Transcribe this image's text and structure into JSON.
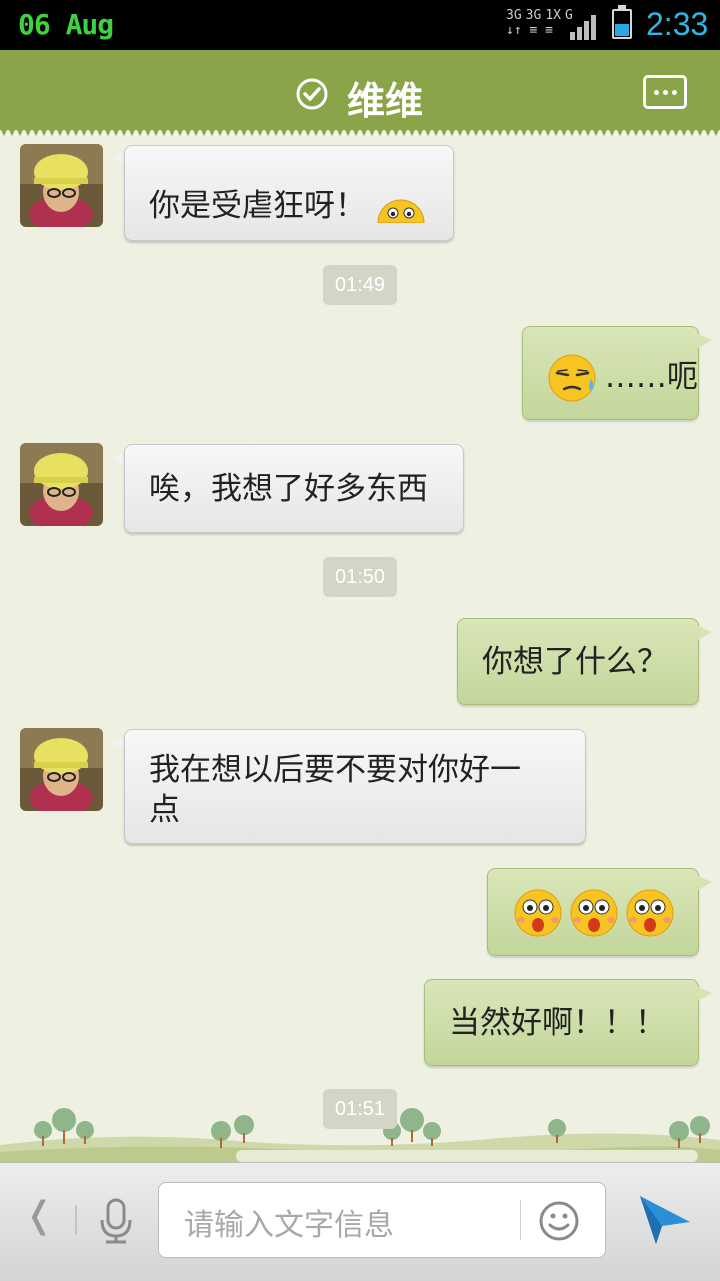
{
  "status_bar": {
    "date": "06 Aug",
    "network_top": [
      "3G",
      "3G",
      "1X",
      "G"
    ],
    "time": "2:33",
    "colors": {
      "date": "#3fd13f",
      "time": "#33b5e5",
      "battery": "#2aa6e0"
    }
  },
  "header": {
    "title": "维维",
    "status_icon": "check-circle-icon",
    "menu_icon": "chat-more-icon",
    "color": "#8aa449"
  },
  "messages": [
    {
      "side": "left",
      "text": "你是受虐狂呀！",
      "emoji": "peeking-face"
    },
    {
      "type": "timestamp",
      "text": "01:49"
    },
    {
      "side": "right",
      "emoji": "sweat-face",
      "text": "……呃"
    },
    {
      "side": "left",
      "text": "唉，我想了好多东西"
    },
    {
      "type": "timestamp",
      "text": "01:50"
    },
    {
      "side": "right",
      "text": "你想了什么？"
    },
    {
      "side": "left",
      "text_line1": "我在想以后要不要对你好一",
      "text_line2": "点"
    },
    {
      "side": "right",
      "emoji": [
        "shocked-face",
        "shocked-face",
        "shocked-face"
      ]
    },
    {
      "side": "right",
      "text": "当然好啊！！！"
    },
    {
      "type": "timestamp",
      "text": "01:51"
    }
  ],
  "input_bar": {
    "placeholder": "请输入文字信息",
    "back_icon": "chevron-left-icon",
    "mic_icon": "microphone-icon",
    "emoji_icon": "smiley-icon",
    "send_icon": "send-icon"
  }
}
